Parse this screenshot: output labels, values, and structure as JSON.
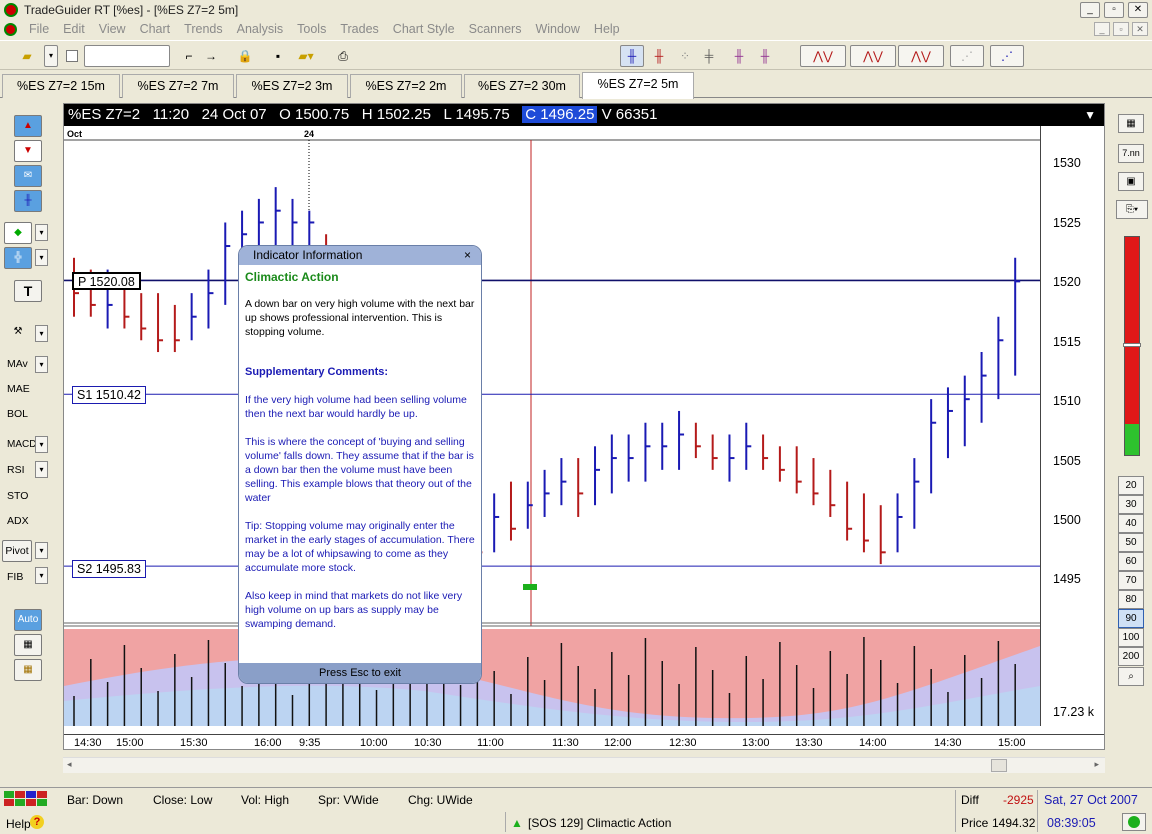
{
  "window": {
    "title": "TradeGuider RT  [%es] - [%ES Z7=2 5m]",
    "buttons": [
      "_",
      "▫",
      "✕"
    ]
  },
  "menu": [
    "File",
    "Edit",
    "View",
    "Chart",
    "Trends",
    "Analysis",
    "Tools",
    "Trades",
    "Chart Style",
    "Scanners",
    "Window",
    "Help"
  ],
  "tabs": [
    "%ES Z7=2 15m",
    "%ES Z7=2 7m",
    "%ES Z7=2 3m",
    "%ES Z7=2 2m",
    "%ES Z7=2 30m",
    "%ES Z7=2 5m"
  ],
  "active_tab": 5,
  "left_tools": {
    "labels": [
      "MAv",
      "MAE",
      "BOL",
      "MACD",
      "RSI",
      "STO",
      "ADX",
      "Pivot",
      "FIB",
      "Auto"
    ],
    "text_tool": "T"
  },
  "infobar": {
    "symbol": "%ES Z7=2",
    "time": "11:20",
    "date": "24 Oct 07",
    "open": "O 1500.75",
    "high": "H 1502.25",
    "low": "L 1495.75",
    "close": "C 1496.25",
    "volume": "V 66351"
  },
  "chart_top_labels": {
    "month": "Oct",
    "day": "24"
  },
  "levels": [
    {
      "label": "P 1520.08",
      "value": 1520.08
    },
    {
      "label": "S1 1510.42",
      "value": 1510.42
    },
    {
      "label": "S2 1495.83",
      "value": 1495.83
    }
  ],
  "volume_label": "17.23 k",
  "chart_data": {
    "type": "bar",
    "y_ticks": [
      "1530",
      "1525",
      "1520",
      "1515",
      "1510",
      "1505",
      "1500",
      "1495"
    ],
    "ylim": [
      1491,
      1532
    ],
    "x_ticks": [
      "14:30",
      "15:00",
      "15:30",
      "16:00",
      "9:35",
      "10:00",
      "10:30",
      "11:00",
      "11:30",
      "12:00",
      "12:30",
      "13:00",
      "13:30",
      "14:00",
      "14:30",
      "15:00"
    ],
    "bars": [
      [
        1517,
        1522,
        1519,
        "r"
      ],
      [
        1517,
        1521,
        1518,
        "r"
      ],
      [
        1516,
        1521,
        1518,
        "b"
      ],
      [
        1516,
        1520,
        1517,
        "r"
      ],
      [
        1515,
        1519,
        1516,
        "r"
      ],
      [
        1514,
        1519,
        1515,
        "r"
      ],
      [
        1514,
        1518,
        1515,
        "r"
      ],
      [
        1515,
        1519,
        1517,
        "b"
      ],
      [
        1516,
        1521,
        1519,
        "b"
      ],
      [
        1518,
        1525,
        1523,
        "b"
      ],
      [
        1521,
        1526,
        1524,
        "b"
      ],
      [
        1521,
        1527,
        1525,
        "b"
      ],
      [
        1522,
        1528,
        1526,
        "b"
      ],
      [
        1523,
        1527,
        1525,
        "b"
      ],
      [
        1523,
        1526,
        1525,
        "b"
      ],
      [
        1522,
        1524,
        1523,
        "r"
      ],
      [
        1521,
        1523,
        1522,
        "r"
      ],
      [
        1515,
        1522,
        1516,
        "r"
      ],
      [
        1512,
        1516,
        1513,
        "r"
      ],
      [
        1510,
        1514,
        1511,
        "r"
      ],
      [
        1508,
        1513,
        1509,
        "r"
      ],
      [
        1505,
        1511,
        1506,
        "r"
      ],
      [
        1503,
        1509,
        1504,
        "r"
      ],
      [
        1499,
        1506,
        1500,
        "r"
      ],
      [
        1496,
        1502,
        1497,
        "r"
      ],
      [
        1497,
        1502,
        1500,
        "b"
      ],
      [
        1498,
        1503,
        1499,
        "r"
      ],
      [
        1499,
        1503,
        1501,
        "b"
      ],
      [
        1500,
        1504,
        1502,
        "b"
      ],
      [
        1501,
        1505,
        1503,
        "b"
      ],
      [
        1500,
        1505,
        1502,
        "r"
      ],
      [
        1501,
        1506,
        1504,
        "b"
      ],
      [
        1502,
        1507,
        1505,
        "b"
      ],
      [
        1503,
        1507,
        1505,
        "b"
      ],
      [
        1503,
        1508,
        1506,
        "b"
      ],
      [
        1504,
        1508,
        1506,
        "b"
      ],
      [
        1504,
        1509,
        1507,
        "b"
      ],
      [
        1505,
        1508,
        1506,
        "r"
      ],
      [
        1504,
        1507,
        1505,
        "r"
      ],
      [
        1503,
        1507,
        1505,
        "b"
      ],
      [
        1504,
        1508,
        1506,
        "b"
      ],
      [
        1504,
        1507,
        1505,
        "r"
      ],
      [
        1503,
        1506,
        1504,
        "r"
      ],
      [
        1502,
        1506,
        1503,
        "r"
      ],
      [
        1501,
        1505,
        1502,
        "r"
      ],
      [
        1500,
        1504,
        1501,
        "r"
      ],
      [
        1498,
        1503,
        1499,
        "r"
      ],
      [
        1497,
        1502,
        1498,
        "r"
      ],
      [
        1496,
        1501,
        1497,
        "r"
      ],
      [
        1497,
        1502,
        1500,
        "b"
      ],
      [
        1499,
        1505,
        1503,
        "b"
      ],
      [
        1502,
        1510,
        1508,
        "b"
      ],
      [
        1505,
        1511,
        1509,
        "b"
      ],
      [
        1506,
        1512,
        1510,
        "b"
      ],
      [
        1508,
        1514,
        1512,
        "b"
      ],
      [
        1510,
        1517,
        1515,
        "b"
      ],
      [
        1512,
        1522,
        1520,
        "b"
      ]
    ]
  },
  "popup": {
    "header": "Indicator Information",
    "close": "×",
    "title": "Climactic Action",
    "p1": "A down bar on very high volume with the next bar up shows professional intervention. This is stopping volume.",
    "supp_title": "Supplementary Comments:",
    "p2": "If the very high volume had been selling volume then the next bar would hardly be up.",
    "p3": "This is where the concept of 'buying and selling volume' falls down. They assume that if the bar is a down bar then the volume must have been selling. This example blows that theory out of the water",
    "p4": "Tip: Stopping volume may originally enter the market in the early stages of accumulation. There may be a lot of whipsawing to come as they accumulate more stock.",
    "p5": "Also keep in mind that markets do not like very high volume on up bars as supply may be swamping demand.",
    "footer": "Press Esc to exit"
  },
  "right_tools": {
    "top": [
      "7.nn"
    ],
    "zoom": [
      "20",
      "30",
      "40",
      "50",
      "60",
      "70",
      "80",
      "90",
      "100",
      "200"
    ],
    "selected_zoom": "90"
  },
  "status": {
    "bar": "Bar: Down",
    "close": "Close: Low",
    "vol": "Vol: High",
    "spr": "Spr: VWide",
    "chg": "Chg: UWide",
    "diff_label": "Diff",
    "diff_value": "-2925",
    "date": "Sat, 27 Oct 2007",
    "help": "Help",
    "signal": "[SOS 129] Climactic Action",
    "price_label": "Price",
    "price_value": "1494.32",
    "clock": "08:39:05"
  },
  "colors": {
    "up_bar": "#1a1ab4",
    "down_bar": "#b41a1a",
    "accent_blue": "#1e4bd8",
    "volume_pink": "#f0a3a3",
    "volume_lavender": "#c8c2ee",
    "volume_blue": "#bcd4f2"
  }
}
